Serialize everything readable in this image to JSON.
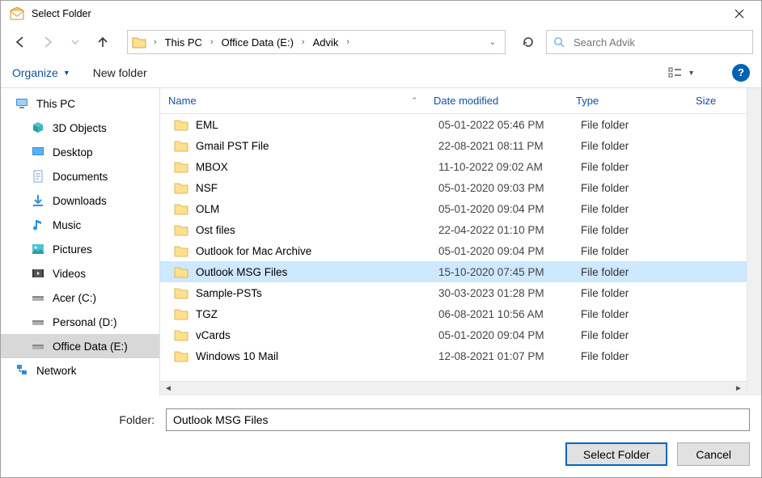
{
  "title": "Select Folder",
  "breadcrumbs": [
    "This PC",
    "Office Data (E:)",
    "Advik"
  ],
  "search_placeholder": "Search Advik",
  "toolbar": {
    "organize": "Organize",
    "new_folder": "New folder"
  },
  "columns": {
    "name": "Name",
    "date": "Date modified",
    "type": "Type",
    "size": "Size"
  },
  "sidebar": [
    {
      "label": "This PC",
      "icon": "monitor",
      "indent": 0,
      "selected": false
    },
    {
      "label": "3D Objects",
      "icon": "cube",
      "indent": 1,
      "selected": false
    },
    {
      "label": "Desktop",
      "icon": "desktop",
      "indent": 1,
      "selected": false
    },
    {
      "label": "Documents",
      "icon": "document",
      "indent": 1,
      "selected": false
    },
    {
      "label": "Downloads",
      "icon": "download",
      "indent": 1,
      "selected": false
    },
    {
      "label": "Music",
      "icon": "music",
      "indent": 1,
      "selected": false
    },
    {
      "label": "Pictures",
      "icon": "picture",
      "indent": 1,
      "selected": false
    },
    {
      "label": "Videos",
      "icon": "video",
      "indent": 1,
      "selected": false
    },
    {
      "label": "Acer (C:)",
      "icon": "drive",
      "indent": 1,
      "selected": false
    },
    {
      "label": "Personal (D:)",
      "icon": "drive",
      "indent": 1,
      "selected": false
    },
    {
      "label": "Office Data (E:)",
      "icon": "drive",
      "indent": 1,
      "selected": true
    },
    {
      "label": "Network",
      "icon": "network",
      "indent": 0,
      "selected": false
    }
  ],
  "files": [
    {
      "name": "EML",
      "date": "05-01-2022 05:46 PM",
      "type": "File folder",
      "selected": false
    },
    {
      "name": "Gmail PST File",
      "date": "22-08-2021 08:11 PM",
      "type": "File folder",
      "selected": false
    },
    {
      "name": "MBOX",
      "date": "11-10-2022 09:02 AM",
      "type": "File folder",
      "selected": false
    },
    {
      "name": "NSF",
      "date": "05-01-2020 09:03 PM",
      "type": "File folder",
      "selected": false
    },
    {
      "name": "OLM",
      "date": "05-01-2020 09:04 PM",
      "type": "File folder",
      "selected": false
    },
    {
      "name": "Ost files",
      "date": "22-04-2022 01:10 PM",
      "type": "File folder",
      "selected": false
    },
    {
      "name": "Outlook for Mac Archive",
      "date": "05-01-2020 09:04 PM",
      "type": "File folder",
      "selected": false
    },
    {
      "name": "Outlook MSG Files",
      "date": "15-10-2020 07:45 PM",
      "type": "File folder",
      "selected": true
    },
    {
      "name": "Sample-PSTs",
      "date": "30-03-2023 01:28 PM",
      "type": "File folder",
      "selected": false
    },
    {
      "name": "TGZ",
      "date": "06-08-2021 10:56 AM",
      "type": "File folder",
      "selected": false
    },
    {
      "name": "vCards",
      "date": "05-01-2020 09:04 PM",
      "type": "File folder",
      "selected": false
    },
    {
      "name": "Windows 10 Mail",
      "date": "12-08-2021 01:07 PM",
      "type": "File folder",
      "selected": false
    }
  ],
  "footer": {
    "folder_label": "Folder:",
    "folder_value": "Outlook MSG Files",
    "select": "Select Folder",
    "cancel": "Cancel"
  }
}
